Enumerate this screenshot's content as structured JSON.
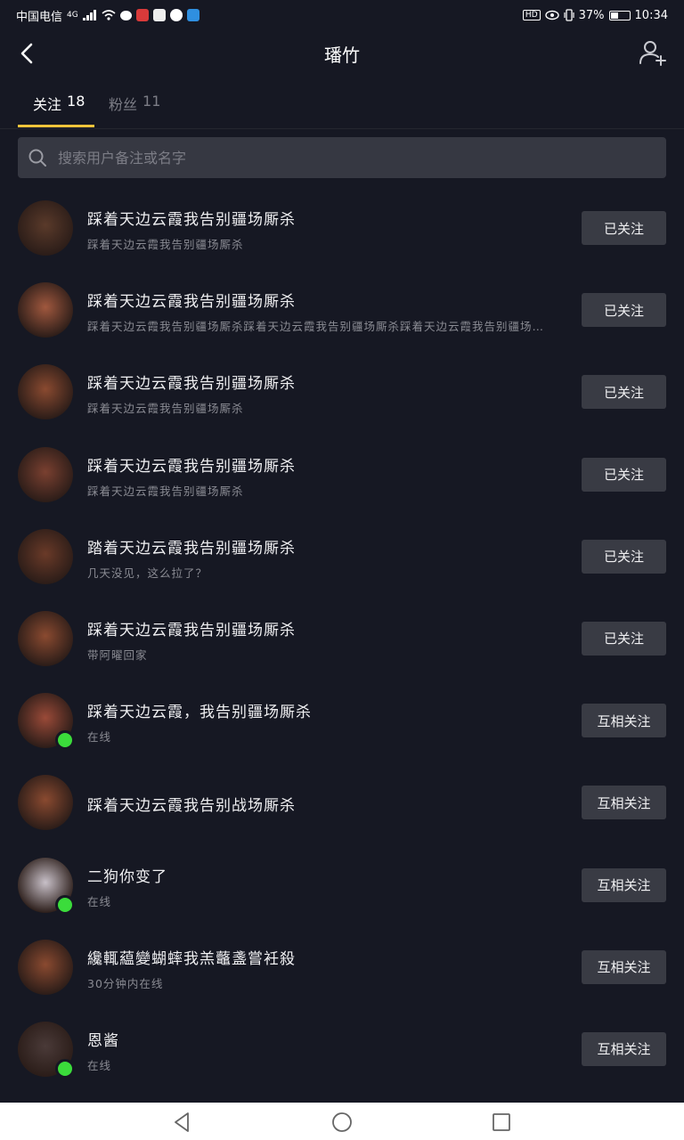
{
  "status_bar": {
    "carrier": "中国电信",
    "network": "4G",
    "battery": "37%",
    "time": "10:34",
    "hd_label": "HD"
  },
  "header": {
    "title": "璠竹",
    "back_icon": "chevron-left-icon",
    "add_icon": "add-friend-icon"
  },
  "tabs": [
    {
      "label": "关注",
      "count": "18",
      "active": true
    },
    {
      "label": "粉丝",
      "count": "11",
      "active": false
    }
  ],
  "search": {
    "placeholder": "搜索用户备注或名字"
  },
  "users": [
    {
      "name": "踩着天边云霞我告别疆场厮杀",
      "sub": "踩着天边云霞我告别疆场厮杀",
      "button": "已关注",
      "online": false,
      "avatar_color": "#5a3a2a"
    },
    {
      "name": "踩着天边云霞我告别疆场厮杀",
      "sub": "踩着天边云霞我告别疆场厮杀踩着天边云霞我告别疆场厮杀踩着天边云霞我告别疆场…",
      "button": "已关注",
      "online": false,
      "avatar_color": "#a0583e"
    },
    {
      "name": "踩着天边云霞我告别疆场厮杀",
      "sub": "踩着天边云霞我告别疆场厮杀",
      "button": "已关注",
      "online": false,
      "avatar_color": "#8a4a30"
    },
    {
      "name": "踩着天边云霞我告别疆场厮杀",
      "sub": "踩着天边云霞我告别疆场厮杀",
      "button": "已关注",
      "online": false,
      "avatar_color": "#7a4030"
    },
    {
      "name": "踏着天边云霞我告别疆场厮杀",
      "sub": "几天没见，这么拉了？",
      "button": "已关注",
      "online": false,
      "avatar_color": "#6a3a28"
    },
    {
      "name": "踩着天边云霞我告别疆场厮杀",
      "sub": "带阿曜回家",
      "button": "已关注",
      "online": false,
      "avatar_color": "#8a4a30"
    },
    {
      "name": "踩着天边云霞，我告别疆场厮杀",
      "sub": "在线",
      "button": "互相关注",
      "online": true,
      "avatar_color": "#9a4a38"
    },
    {
      "name": "踩着天边云霞我告别战场厮杀",
      "sub": "",
      "button": "互相关注",
      "online": false,
      "avatar_color": "#8a4a30"
    },
    {
      "name": "二狗你变了",
      "sub": "在线",
      "button": "互相关注",
      "online": true,
      "avatar_color": "#c8c0c8"
    },
    {
      "name": "纔輒藴變蝴蟀我羔虌盞嘗衽殺",
      "sub": "30分钟内在线",
      "button": "互相关注",
      "online": false,
      "avatar_color": "#8a4a30"
    },
    {
      "name": "恩酱",
      "sub": "在线",
      "button": "互相关注",
      "online": true,
      "avatar_color": "#4a3a38"
    }
  ],
  "nav": {
    "back_icon": "triangle-back-icon",
    "home_icon": "circle-home-icon",
    "recent_icon": "square-recent-icon"
  }
}
